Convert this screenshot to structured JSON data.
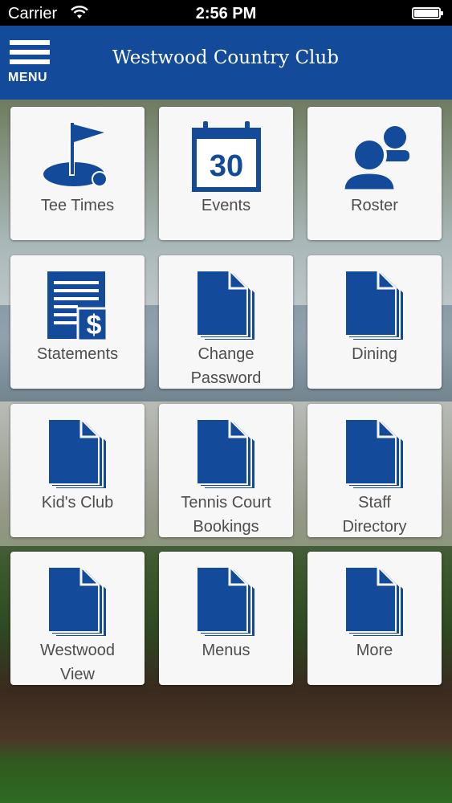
{
  "status_bar": {
    "carrier": "Carrier",
    "time": "2:56 PM"
  },
  "header": {
    "menu_label": "MENU",
    "title": "Westwood Country Club"
  },
  "colors": {
    "brand_blue": "#134a9a",
    "tile_bg": "#f7f7f7",
    "label_gray": "#4d4d4d"
  },
  "tiles": [
    {
      "label": "Tee Times",
      "icon": "golf-flag-icon"
    },
    {
      "label": "Events",
      "icon": "calendar-icon",
      "day": "30"
    },
    {
      "label": "Roster",
      "icon": "people-icon"
    },
    {
      "label": "Statements",
      "icon": "statement-dollar-icon"
    },
    {
      "label": "Change\nPassword",
      "icon": "document-icon"
    },
    {
      "label": "Dining",
      "icon": "document-icon"
    },
    {
      "label": "Kid's Club",
      "icon": "document-icon"
    },
    {
      "label": "Tennis Court\nBookings",
      "icon": "document-icon"
    },
    {
      "label": "Staff\nDirectory",
      "icon": "document-icon"
    },
    {
      "label": "Westwood\nView",
      "icon": "document-icon"
    },
    {
      "label": "Menus",
      "icon": "document-icon"
    },
    {
      "label": "More",
      "icon": "document-icon"
    }
  ]
}
